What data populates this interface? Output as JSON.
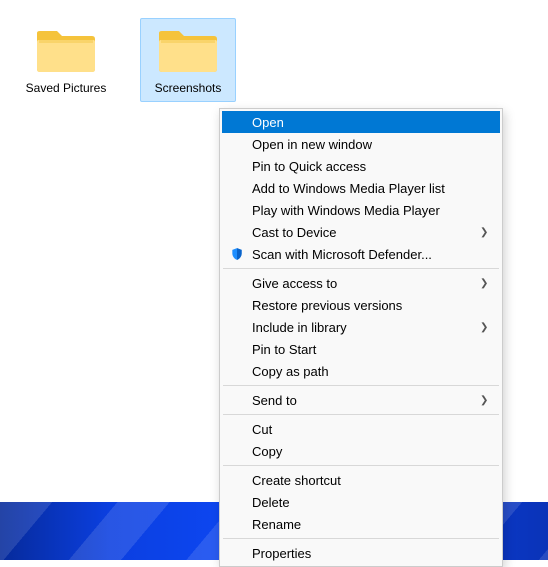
{
  "folders": [
    {
      "label": "Saved Pictures",
      "selected": false
    },
    {
      "label": "Screenshots",
      "selected": true
    }
  ],
  "context_menu": {
    "groups": [
      [
        {
          "label": "Open",
          "highlight": true
        },
        {
          "label": "Open in new window"
        },
        {
          "label": "Pin to Quick access"
        },
        {
          "label": "Add to Windows Media Player list"
        },
        {
          "label": "Play with Windows Media Player"
        },
        {
          "label": "Cast to Device",
          "submenu": true
        },
        {
          "label": "Scan with Microsoft Defender...",
          "icon": "defender-shield-icon"
        }
      ],
      [
        {
          "label": "Give access to",
          "submenu": true
        },
        {
          "label": "Restore previous versions"
        },
        {
          "label": "Include in library",
          "submenu": true
        },
        {
          "label": "Pin to Start"
        },
        {
          "label": "Copy as path"
        }
      ],
      [
        {
          "label": "Send to",
          "submenu": true
        }
      ],
      [
        {
          "label": "Cut"
        },
        {
          "label": "Copy"
        }
      ],
      [
        {
          "label": "Create shortcut"
        },
        {
          "label": "Delete"
        },
        {
          "label": "Rename"
        }
      ],
      [
        {
          "label": "Properties"
        }
      ]
    ]
  }
}
